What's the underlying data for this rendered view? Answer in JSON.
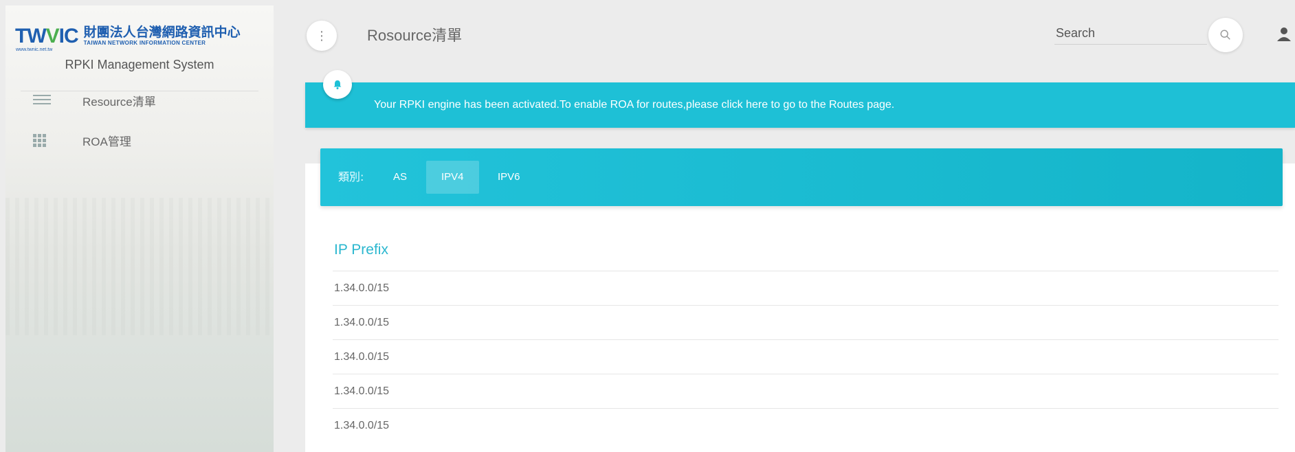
{
  "sidebar": {
    "logo": {
      "mark": "TWNIC",
      "url": "www.twnic.net.tw",
      "name_zh": "財團法人台灣網路資訊中心",
      "name_en": "TAIWAN NETWORK INFORMATION CENTER"
    },
    "system_title": "RPKI Management System",
    "items": [
      {
        "label": "Resource清單",
        "icon": "list-icon"
      },
      {
        "label": "ROA管理",
        "icon": "grid-icon"
      }
    ]
  },
  "header": {
    "title": "Rosource清單",
    "search_placeholder": "Search",
    "menu_icon": "more-vert-icon",
    "search_icon": "search-icon",
    "user_icon": "user-icon"
  },
  "banner": {
    "text": "Your RPKI engine has been activated.To enable ROA for routes,please click here to go to the Routes page.",
    "icon": "bell-icon",
    "color": "#1ec0d6"
  },
  "tabs": {
    "label": "類別:",
    "items": [
      "AS",
      "IPV4",
      "IPV6"
    ],
    "active": "IPV4"
  },
  "table": {
    "header": "IP Prefix",
    "rows": [
      "1.34.0.0/15",
      "1.34.0.0/15",
      "1.34.0.0/15",
      "1.34.0.0/15",
      "1.34.0.0/15"
    ]
  },
  "colors": {
    "accent": "#2bb7cf",
    "logo_blue": "#1f5fb0",
    "logo_green": "#4caf50"
  }
}
